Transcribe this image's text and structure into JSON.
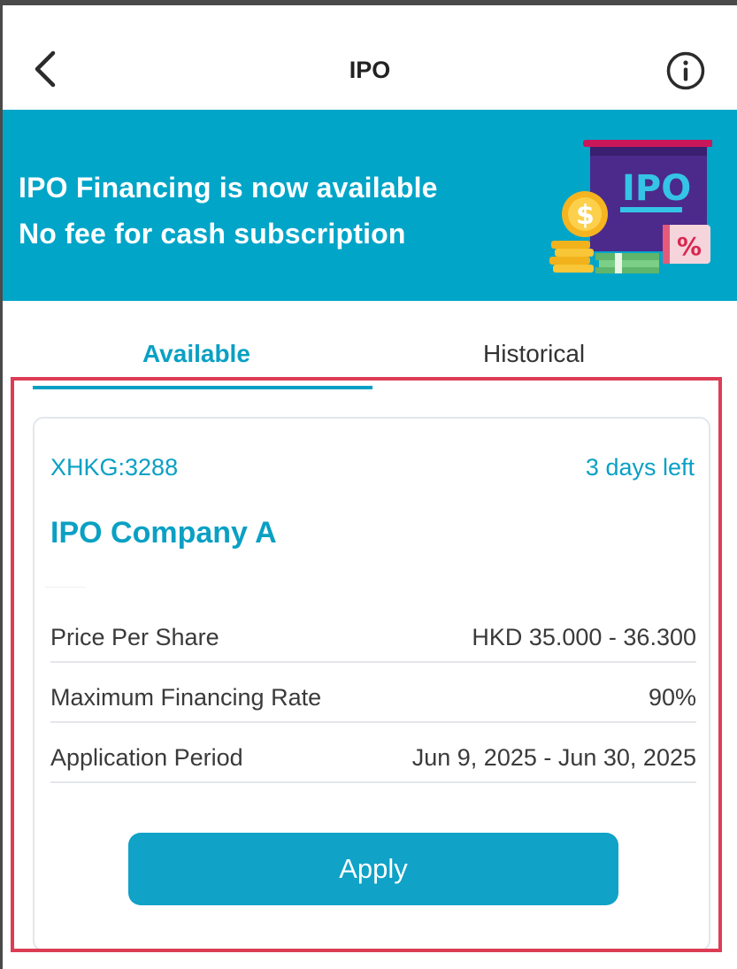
{
  "header": {
    "title": "IPO",
    "back_icon": "chevron-left-icon",
    "info_icon": "info-icon"
  },
  "banner": {
    "line1": "IPO Financing is now available",
    "line2": "No fee for cash subscription",
    "art_text": "IPO",
    "art_badge": "%",
    "background": "#00a5c8"
  },
  "tabs": [
    {
      "label": "Available",
      "active": true
    },
    {
      "label": "Historical",
      "active": false
    }
  ],
  "ipo_card": {
    "ticker": "XHKG:3288",
    "days_left": "3 days left",
    "company": "IPO Company A",
    "rows": [
      {
        "label": "Price Per Share",
        "value": "HKD 35.000 - 36.300"
      },
      {
        "label": "Maximum Financing Rate",
        "value": "90%"
      },
      {
        "label": "Application Period",
        "value": "Jun 9, 2025 -  Jun 30, 2025"
      }
    ],
    "apply_label": "Apply"
  },
  "colors": {
    "accent": "#0aa0c4",
    "highlight_border": "#dc3d55"
  }
}
